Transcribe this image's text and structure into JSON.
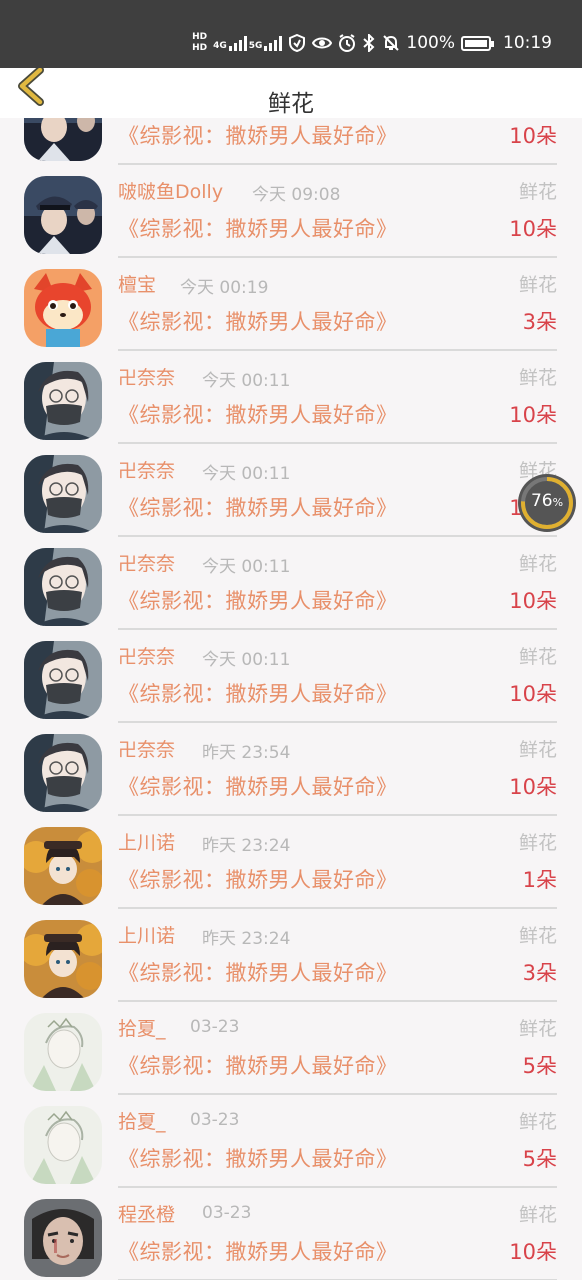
{
  "status_bar": {
    "hd1": "HD",
    "hd2": "HD",
    "net1": "4G",
    "net2": "5G",
    "battery_pct": "100%",
    "time": "10:19",
    "icons": [
      "signal-icon",
      "vpn-icon",
      "eye-icon",
      "alarm-icon",
      "bluetooth-icon",
      "mute-icon",
      "battery-icon"
    ]
  },
  "nav": {
    "title": "鲜花",
    "back_icon": "chevron-left-icon",
    "accent": "#e0b840"
  },
  "list": {
    "rows": [
      {
        "name": "",
        "time": "",
        "gift": "",
        "book": "《综影视：撒娇男人最好命》",
        "count": "10朵",
        "avatar": "police"
      },
      {
        "name": "啵啵鱼Dolly",
        "time": "今天 09:08",
        "gift": "鲜花",
        "book": "《综影视：撒娇男人最好命》",
        "count": "10朵",
        "avatar": "police"
      },
      {
        "name": "檀宝",
        "time": "今天 00:19",
        "gift": "鲜花",
        "book": "《综影视：撒娇男人最好命》",
        "count": "3朵",
        "avatar": "fox"
      },
      {
        "name": "卍奈奈",
        "time": "今天 00:11",
        "gift": "鲜花",
        "book": "《综影视：撒娇男人最好命》",
        "count": "10朵",
        "avatar": "mask"
      },
      {
        "name": "卍奈奈",
        "time": "今天 00:11",
        "gift": "鲜花",
        "book": "《综影视：撒娇男人最好命》",
        "count": "10朵",
        "avatar": "mask"
      },
      {
        "name": "卍奈奈",
        "time": "今天 00:11",
        "gift": "鲜花",
        "book": "《综影视：撒娇男人最好命》",
        "count": "10朵",
        "avatar": "mask"
      },
      {
        "name": "卍奈奈",
        "time": "今天 00:11",
        "gift": "鲜花",
        "book": "《综影视：撒娇男人最好命》",
        "count": "10朵",
        "avatar": "mask"
      },
      {
        "name": "卍奈奈",
        "time": "昨天 23:54",
        "gift": "鲜花",
        "book": "《综影视：撒娇男人最好命》",
        "count": "10朵",
        "avatar": "mask"
      },
      {
        "name": "上川诺",
        "time": "昨天 23:24",
        "gift": "鲜花",
        "book": "《综影视：撒娇男人最好命》",
        "count": "1朵",
        "avatar": "autumn"
      },
      {
        "name": "上川诺",
        "time": "昨天 23:24",
        "gift": "鲜花",
        "book": "《综影视：撒娇男人最好命》",
        "count": "3朵",
        "avatar": "autumn"
      },
      {
        "name": "拾夏_",
        "time": "03-23",
        "gift": "鲜花",
        "book": "《综影视：撒娇男人最好命》",
        "count": "5朵",
        "avatar": "sketch"
      },
      {
        "name": "拾夏_",
        "time": "03-23",
        "gift": "鲜花",
        "book": "《综影视：撒娇男人最好命》",
        "count": "5朵",
        "avatar": "sketch"
      },
      {
        "name": "程丞橙",
        "time": "03-23",
        "gift": "鲜花",
        "book": "《综影视：撒娇男人最好命》",
        "count": "10朵",
        "avatar": "man"
      }
    ]
  },
  "overlay": {
    "gauge_value": "76",
    "gauge_unit": "%",
    "gauge_fraction": 0.76
  },
  "colors": {
    "name": "#e8906a",
    "count": "#d8434a",
    "muted": "#b8b8b8",
    "background": "#f7f5f6"
  }
}
